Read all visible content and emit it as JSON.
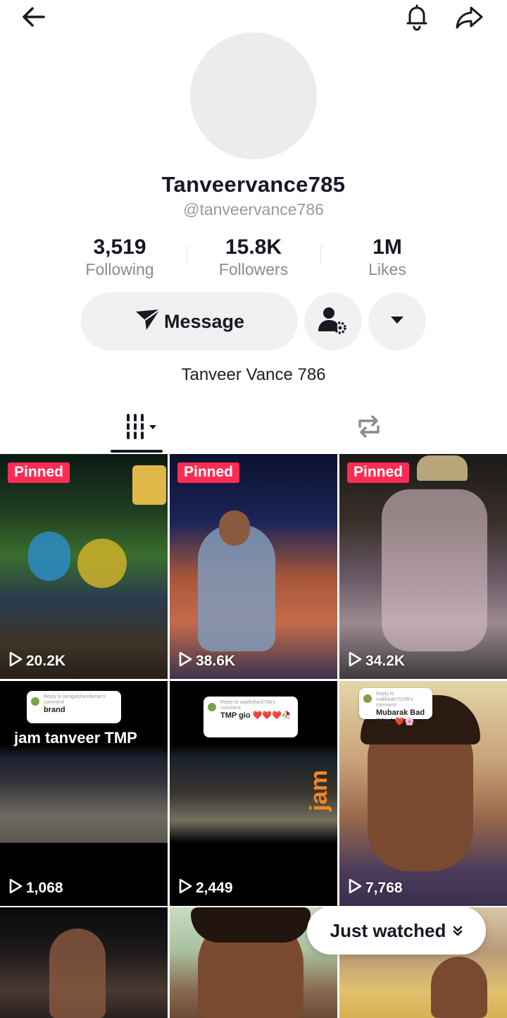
{
  "profile": {
    "display_name": "Tanveervance785",
    "handle": "@tanveervance786",
    "bio": "Tanveer Vance 786"
  },
  "stats": [
    {
      "value": "3,519",
      "label": "Following"
    },
    {
      "value": "15.8K",
      "label": "Followers"
    },
    {
      "value": "1M",
      "label": "Likes"
    }
  ],
  "actions": {
    "message_label": "Message"
  },
  "icons": {
    "back": "back-arrow-icon",
    "bell": "bell-icon",
    "share": "share-icon",
    "message": "send-icon",
    "manage_user": "user-settings-icon",
    "more": "caret-down-icon",
    "videos_tab": "grid-icon",
    "reposts_tab": "repost-icon",
    "play": "play-icon"
  },
  "videos": [
    {
      "pinned": "Pinned",
      "views": "20.2K"
    },
    {
      "pinned": "Pinned",
      "views": "38.6K"
    },
    {
      "pinned": "Pinned",
      "views": "34.2K"
    },
    {
      "views": "1,068",
      "overlay": "jam tanveer TMP",
      "comment": "brand"
    },
    {
      "views": "2,449",
      "comment": "TMP gio ❤️❤️❤️🥀",
      "vertical": "jam"
    },
    {
      "views": "7,768",
      "comment": "Mubarak Bad Bhai ❤️🌸"
    }
  ],
  "just_watched_label": "Just watched",
  "colors": {
    "pinned_badge": "#fe2c55",
    "button_bg": "#f1f1f2",
    "text": "#161823",
    "muted": "#8a8b91"
  }
}
